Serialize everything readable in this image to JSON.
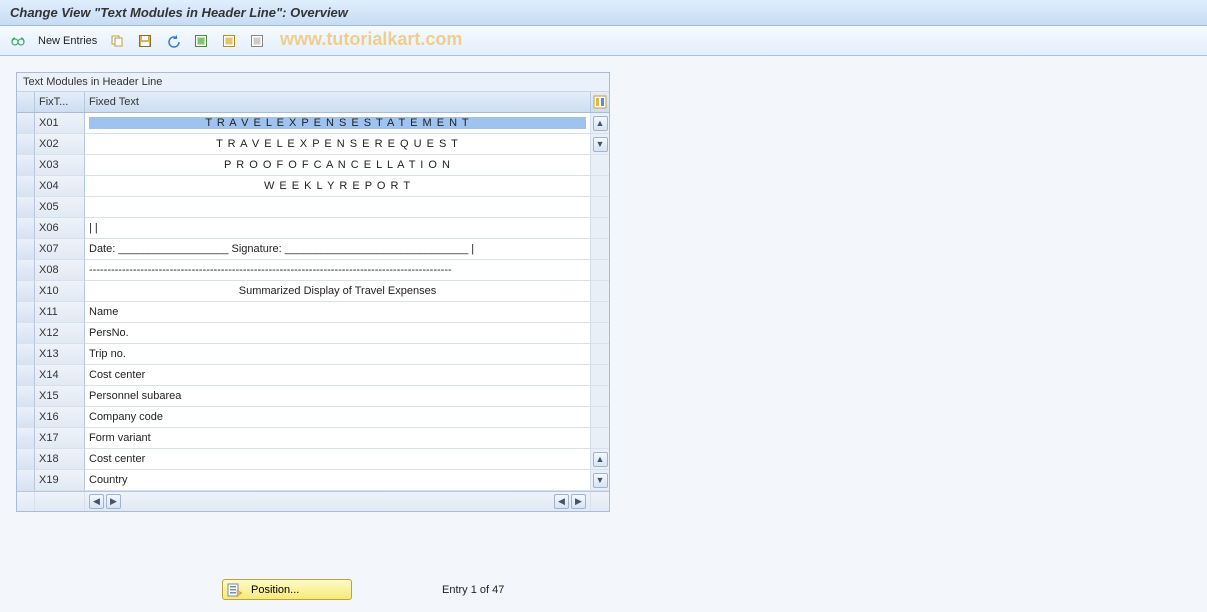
{
  "header": {
    "title": "Change View \"Text Modules in Header Line\": Overview"
  },
  "toolbar": {
    "new_entries": "New Entries"
  },
  "watermark": "www.tutorialkart.com",
  "panel": {
    "title": "Text Modules in Header Line",
    "columns": {
      "code": "FixT...",
      "text": "Fixed Text"
    },
    "rows": [
      {
        "code": "X01",
        "text": "T R A V E L  E X P E N S E  S T A T E M E N T",
        "style": "centered-text",
        "selected": true
      },
      {
        "code": "X02",
        "text": "T R A V E L  E X P E N S E   R E Q U E S T",
        "style": "centered-text"
      },
      {
        "code": "X03",
        "text": "P R O O F  O F  C A N C E L L A T I O N",
        "style": "centered-text"
      },
      {
        "code": "X04",
        "text": "W E E K L Y  R E P O R T",
        "style": "centered-text"
      },
      {
        "code": "X05",
        "text": ""
      },
      {
        "code": "X06",
        "text": "|                                                                                                                               |"
      },
      {
        "code": "X07",
        "text": "   Date: __________________          Signature: ______________________________      |"
      },
      {
        "code": "X08",
        "text": "---------------------------------------------------------------------------------------------------"
      },
      {
        "code": "X10",
        "text": "Summarized Display of Travel Expenses",
        "style": "centered-normal"
      },
      {
        "code": "X11",
        "text": "Name"
      },
      {
        "code": "X12",
        "text": "PersNo."
      },
      {
        "code": "X13",
        "text": "Trip no."
      },
      {
        "code": "X14",
        "text": "Cost center"
      },
      {
        "code": "X15",
        "text": "Personnel subarea"
      },
      {
        "code": "X16",
        "text": "Company code"
      },
      {
        "code": "X17",
        "text": "Form variant"
      },
      {
        "code": "X18",
        "text": "Cost center"
      },
      {
        "code": "X19",
        "text": "Country"
      }
    ]
  },
  "footer": {
    "position_label": "Position...",
    "entry_text": "Entry 1 of 47"
  }
}
